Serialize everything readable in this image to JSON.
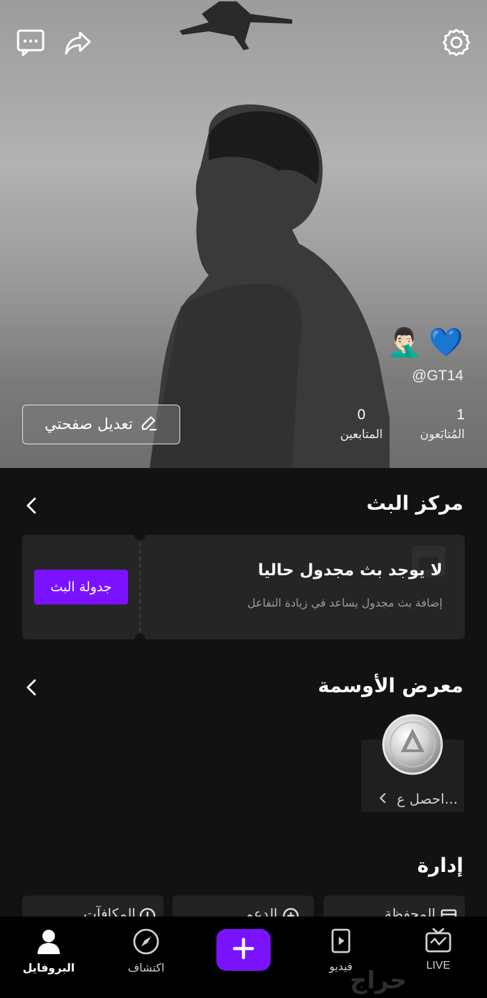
{
  "header": {
    "handle": "@GT14",
    "emojis": [
      "💙",
      "🤦🏻‍♂️"
    ],
    "stats": {
      "following": {
        "count": "1",
        "label": "المُتابَعون"
      },
      "followers": {
        "count": "0",
        "label": "المتابعين"
      }
    },
    "edit_button": "تعديل صفحتي",
    "icons": [
      "message-icon",
      "share-icon",
      "gear-icon"
    ]
  },
  "live_center": {
    "title": "مركز البث",
    "card_title": "لا يوجد بث مجدول حاليا",
    "card_subtitle": "إضافة بث مجدول يساعد في زيادة التفاعل",
    "schedule_button": "جدولة البث"
  },
  "badges": {
    "title": "معرض الأوسمة",
    "item_label": "احصل ع..."
  },
  "management": {
    "title": "إدارة",
    "tiles": [
      "المحفظة",
      "الدعم",
      "المكافآت"
    ]
  },
  "bottom_nav": {
    "items": [
      {
        "label": "LIVE",
        "icon": "live-tv-icon"
      },
      {
        "label": "فيديو",
        "icon": "video-icon"
      },
      {
        "label": "اكتشاف",
        "icon": "compass-icon"
      },
      {
        "label": "البروفايل",
        "icon": "profile-icon"
      }
    ],
    "plus_icon": "plus-icon",
    "watermark": "حراج"
  },
  "colors": {
    "accent": "#7b12ff",
    "background": "#121212",
    "card": "#252525"
  }
}
